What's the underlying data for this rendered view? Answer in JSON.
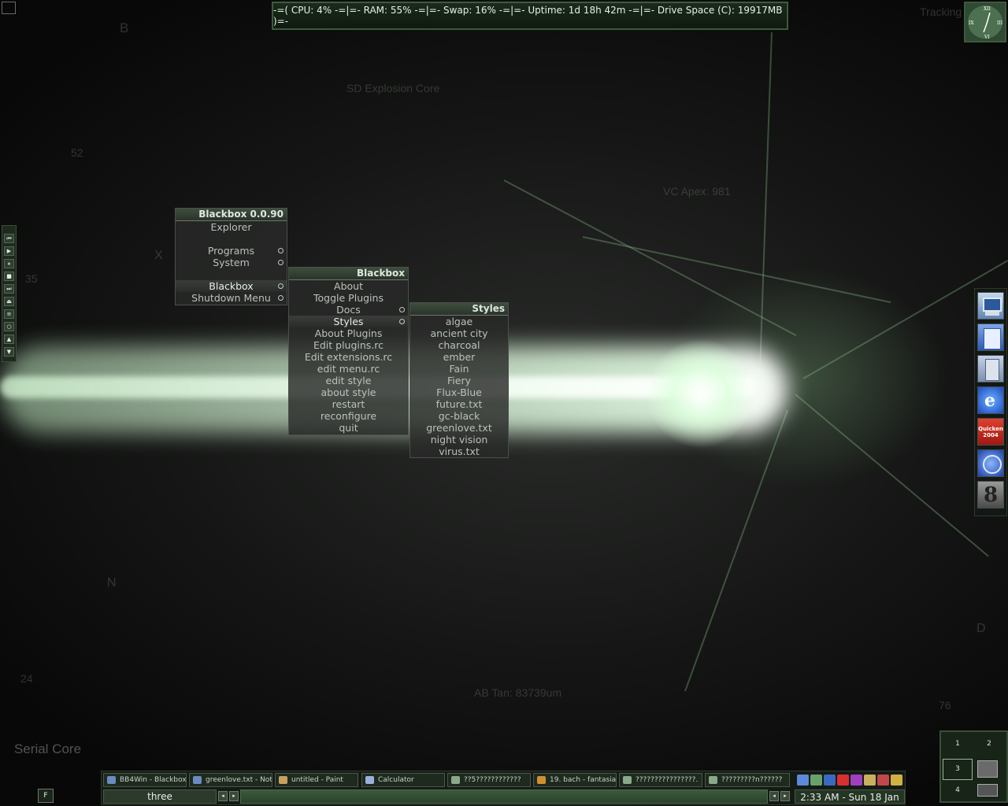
{
  "sysmon": {
    "text": "-=( CPU: 4% -=|=- RAM: 55% -=|=- Swap: 16% -=|=- Uptime: 1d 18h 42m -=|=- Drive Space (C): 19917MB )=-"
  },
  "wallpaper": {
    "labels": [
      "B",
      "52",
      "35",
      "X",
      "24",
      "N",
      "Serial Core",
      "SD Explosion Core",
      "VC Apex: 981",
      "AB Tan: 83739um",
      "D",
      "76",
      "Tracking"
    ]
  },
  "clock": {
    "numerals": [
      "XII",
      "IX",
      "III",
      "VI"
    ]
  },
  "media_bar": {
    "buttons": [
      "⏮",
      "▶",
      "⏸",
      "■",
      "⏭",
      "⏏",
      "≡",
      "○",
      "▲",
      "▼"
    ]
  },
  "menu_main": {
    "title": "Blackbox 0.0.90",
    "items": [
      {
        "label": "Explorer"
      },
      {
        "label": "",
        "spacer": true
      },
      {
        "label": "Programs",
        "submenu": true
      },
      {
        "label": "System",
        "submenu": true
      },
      {
        "label": "",
        "spacer": true
      },
      {
        "label": "Blackbox",
        "submenu": true,
        "active": true
      },
      {
        "label": "Shutdown Menu",
        "submenu": true
      }
    ]
  },
  "menu_blackbox": {
    "title": "Blackbox",
    "items": [
      {
        "label": "About"
      },
      {
        "label": "Toggle Plugins"
      },
      {
        "label": "Docs",
        "submenu": true
      },
      {
        "label": "Styles",
        "submenu": true,
        "active": true
      },
      {
        "label": "About Plugins"
      },
      {
        "label": "Edit plugins.rc"
      },
      {
        "label": "Edit extensions.rc"
      },
      {
        "label": "edit menu.rc"
      },
      {
        "label": "edit style"
      },
      {
        "label": "about style"
      },
      {
        "label": "restart"
      },
      {
        "label": "reconfigure"
      },
      {
        "label": "quit"
      }
    ]
  },
  "menu_styles": {
    "title": "Styles",
    "items": [
      "algae",
      "ancient city",
      "charcoal",
      "ember",
      "Fain",
      "Fiery",
      "Flux-Blue",
      "future.txt",
      "gc-black",
      "greenlove.txt",
      "night vision",
      "virus.txt"
    ]
  },
  "dock": {
    "icons": [
      {
        "name": "my-computer-icon",
        "color": "#7fa7d8"
      },
      {
        "name": "notepad-icon",
        "color": "#4a7ad8"
      },
      {
        "name": "calculator-icon",
        "color": "#9ab0d8"
      },
      {
        "name": "internet-explorer-icon",
        "color": "#2a6ae0"
      },
      {
        "name": "quicken-2004-icon",
        "color": "#c8261e",
        "label": "Quicken 2004"
      },
      {
        "name": "globe-icon",
        "color": "#2f5fd0"
      },
      {
        "name": "eight-ball-icon",
        "color": "#8a8a8a",
        "label": "8"
      }
    ]
  },
  "pager": {
    "workspaces": [
      "1",
      "2",
      "3",
      "4"
    ]
  },
  "taskbar": {
    "tasks": [
      {
        "label": "BB4Win - Blackbox"
      },
      {
        "label": "greenlove.txt - Note"
      },
      {
        "label": "untitled - Paint"
      },
      {
        "label": "Calculator"
      },
      {
        "label": "??5????????????"
      },
      {
        "label": "19. bach - fantasia"
      },
      {
        "label": "????????????????."
      },
      {
        "label": "?????????n??????"
      }
    ],
    "workspace_name": "three",
    "clock": "2:33 AM - Sun 18 Jan",
    "prev_label": "◂",
    "next_label": "▸"
  },
  "corner_box": {
    "label": "F"
  }
}
